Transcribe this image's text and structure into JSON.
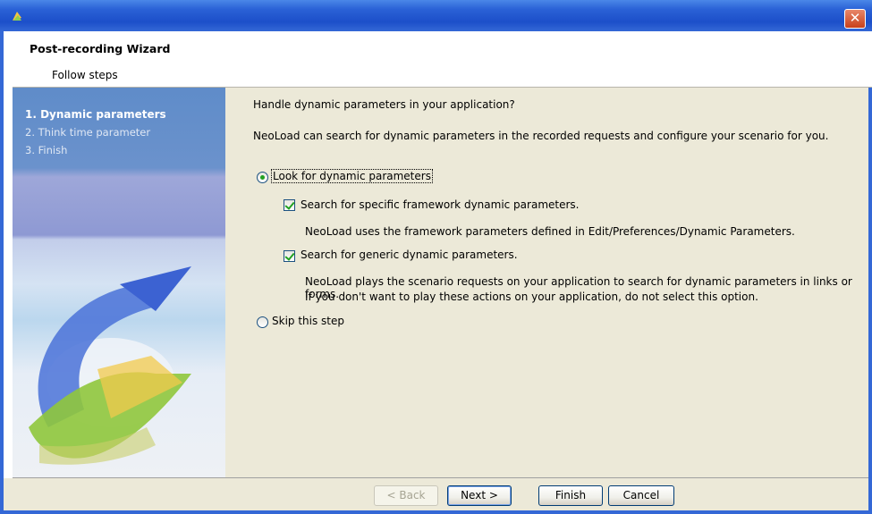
{
  "window": {
    "close_glyph": "✕",
    "icon": "app-icon"
  },
  "header": {
    "title": "Post-recording Wizard",
    "subtitle": "Follow steps"
  },
  "sidebar": {
    "steps": [
      "1. Dynamic parameters",
      "2. Think time parameter",
      "3. Finish"
    ],
    "active_step": 0
  },
  "content": {
    "question": "Handle dynamic parameters in your application?",
    "intro": "NeoLoad can search for dynamic parameters in the recorded requests and configure your scenario for you.",
    "look_option": {
      "label": "Look for dynamic parameters",
      "selected": true
    },
    "framework_option": {
      "label": "Search for specific framework dynamic parameters.",
      "checked": true,
      "description": "NeoLoad uses the framework parameters defined in Edit/Preferences/Dynamic Parameters."
    },
    "generic_option": {
      "label": "Search for generic dynamic parameters.",
      "checked": true,
      "description_line1": "NeoLoad plays the scenario requests on your application to search for dynamic parameters in links or forms.",
      "description_line2": "If you don't want to play these actions on your application, do not select this option."
    },
    "skip_option": {
      "label": "Skip this step",
      "selected": false
    }
  },
  "buttons": {
    "back": "< Back",
    "next": "Next >",
    "finish": "Finish",
    "cancel": "Cancel"
  },
  "colors": {
    "titlebar": "#1c4fc9",
    "dialog_bg": "#ece9d8",
    "sidebar_top": "#5f8cc9",
    "check_green": "#21a121"
  }
}
